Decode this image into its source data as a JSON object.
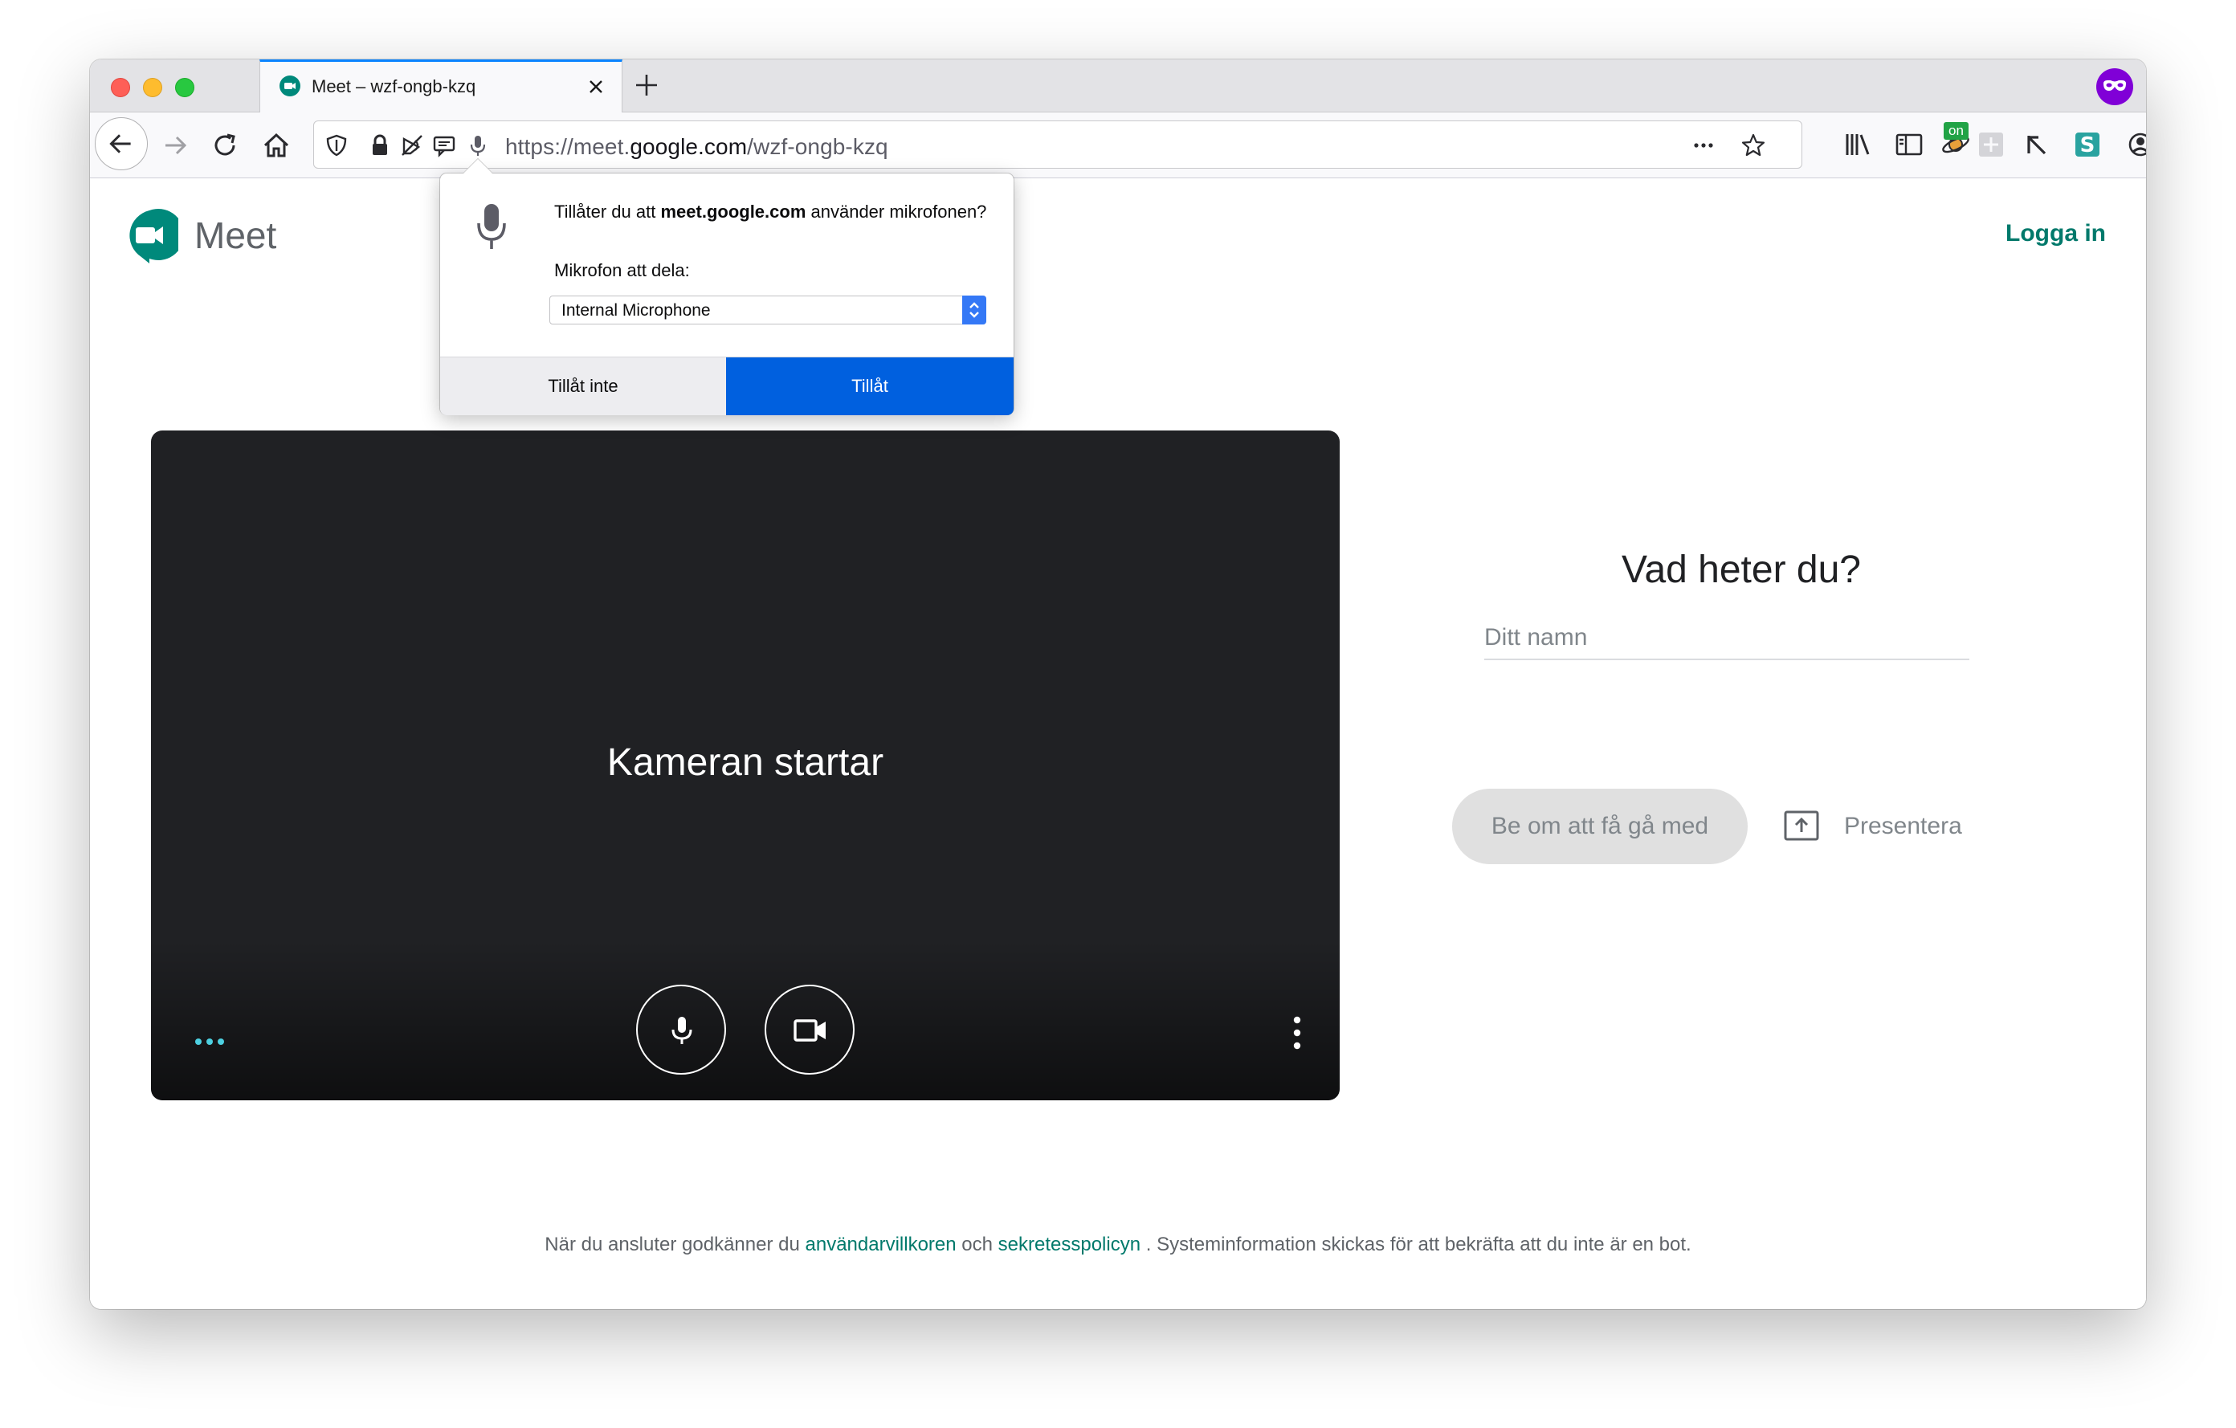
{
  "browser": {
    "tab_title": "Meet – wzf-ongb-kzq",
    "url_prefix": "https://meet.",
    "url_host": "google.com",
    "url_path": "/wzf-ongb-kzq",
    "badge_on": "on",
    "accent_color": "#0a84ff",
    "private_color": "#8000d7"
  },
  "permission_popup": {
    "question_pre": "Tillåter du att ",
    "question_host": "meet.google.com",
    "question_post": " använder mikrofonen?",
    "label": "Mikrofon att dela:",
    "selected_device": "Internal Microphone",
    "deny_label": "Tillåt inte",
    "allow_label": "Tillåt",
    "allow_color": "#0060df"
  },
  "meet": {
    "brand": "Meet",
    "login_label": "Logga in",
    "brand_color": "#00796b",
    "camera_status": "Kameran startar",
    "join_title": "Vad heter du?",
    "name_placeholder": "Ditt namn",
    "ask_join_label": "Be om att få gå med",
    "present_label": "Presentera"
  },
  "footer": {
    "text_before": "När du ansluter godkänner du ",
    "terms_link": "användarvillkoren",
    "text_middle": " och ",
    "privacy_link": "sekretesspolicyn",
    "text_after": " . Systeminformation skickas för att bekräfta att du inte är en bot."
  }
}
